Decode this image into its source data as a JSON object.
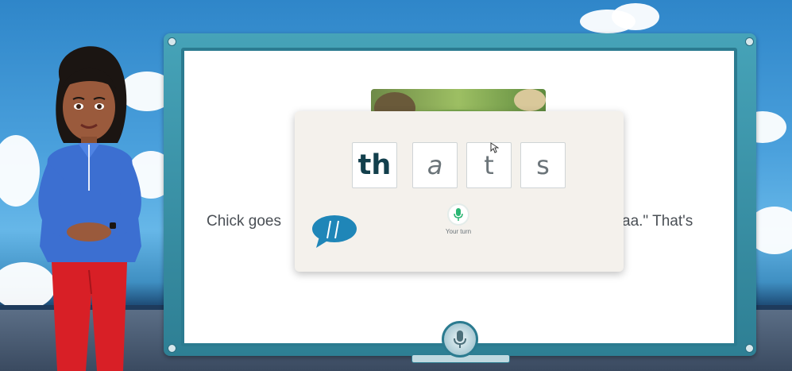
{
  "story": {
    "left_text": "Chick goes",
    "right_text": "aa.\" That's"
  },
  "word_tiles": [
    {
      "text": "th",
      "state": "active"
    },
    {
      "text": "a",
      "state": "normal"
    },
    {
      "text": "t",
      "state": "normal"
    },
    {
      "text": "s",
      "state": "normal"
    }
  ],
  "popup": {
    "mic_label": "Your turn"
  },
  "colors": {
    "board_frame": "#46a3b8",
    "mic_green": "#2bb673",
    "speech_blue": "#1f86b8"
  },
  "icons": [
    "speech-bubble-icon",
    "microphone-icon",
    "mouse-cursor-icon"
  ]
}
